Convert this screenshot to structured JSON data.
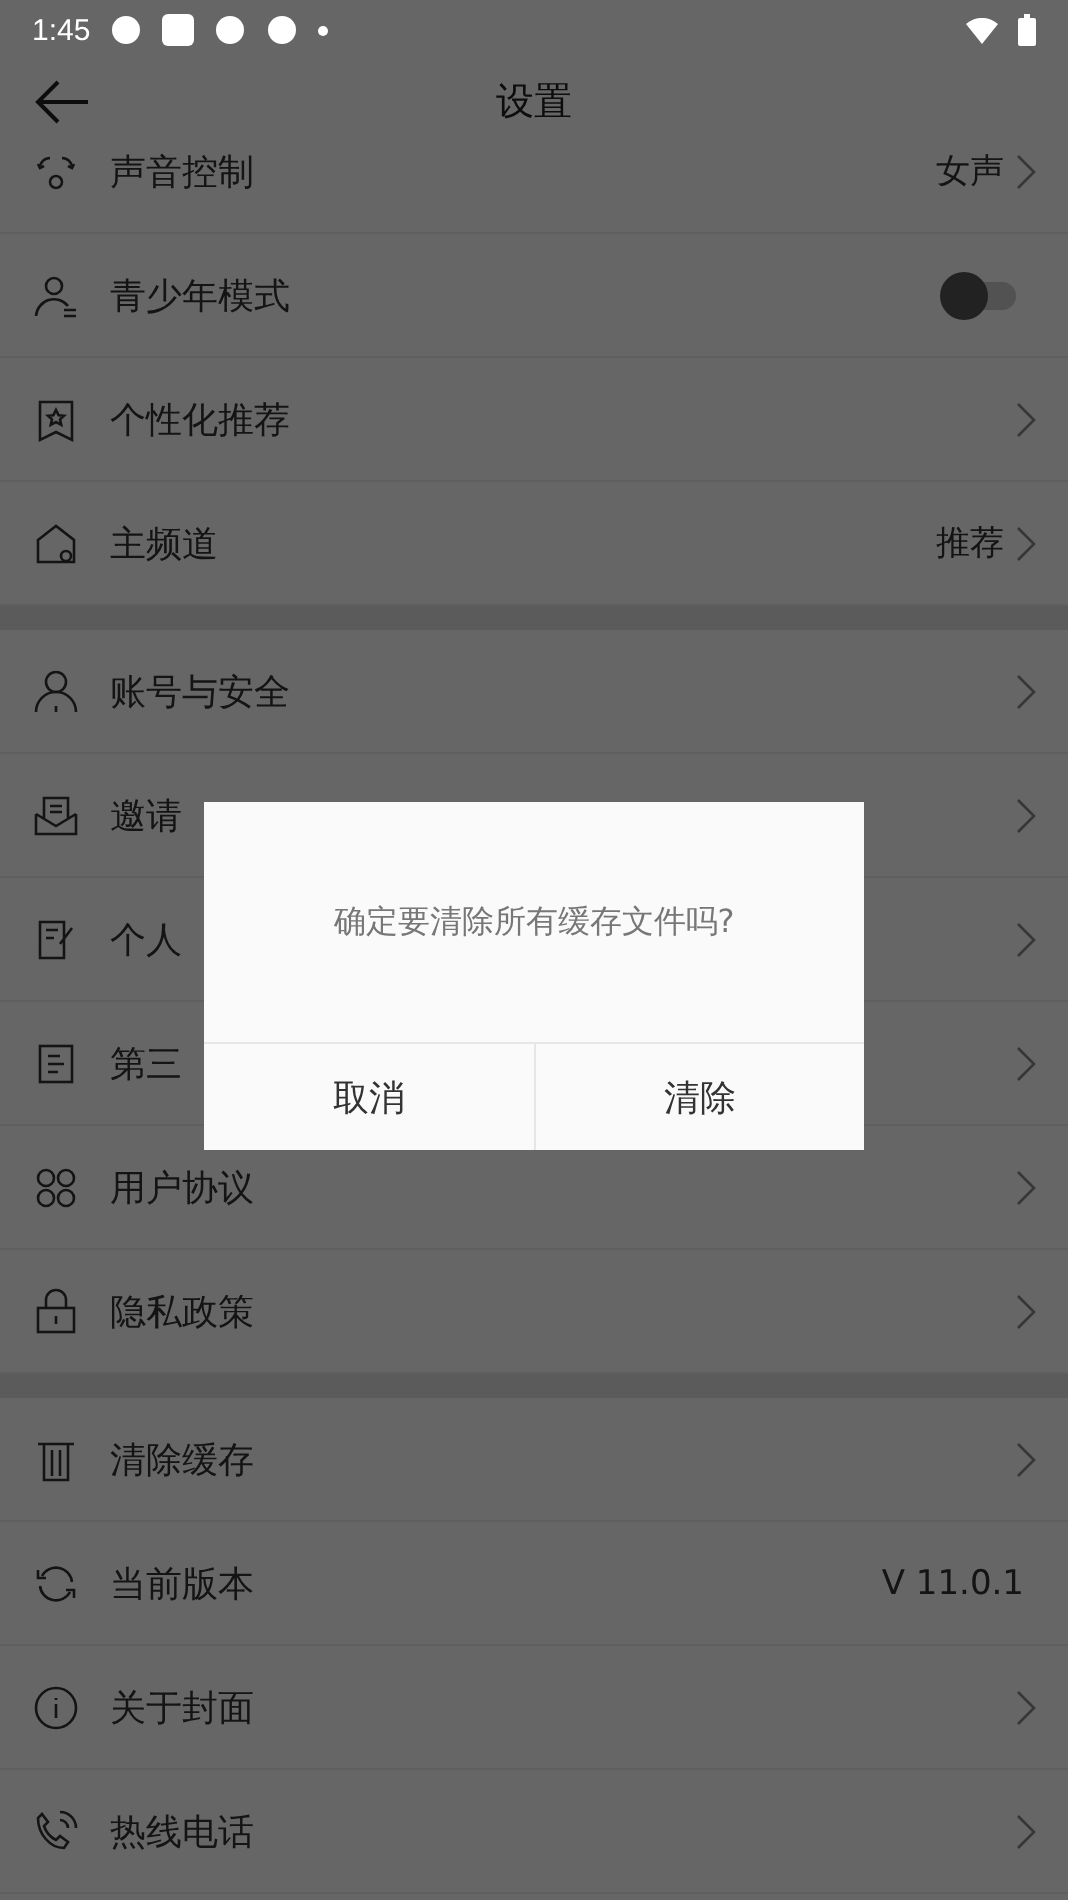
{
  "status_bar": {
    "time": "1:45"
  },
  "header": {
    "title": "设置"
  },
  "sections": [
    {
      "rows": [
        {
          "label": "声音控制",
          "kind": "chevron",
          "value": "女声"
        },
        {
          "label": "青少年模式",
          "kind": "switch",
          "on": false
        },
        {
          "label": "个性化推荐",
          "kind": "chevron"
        },
        {
          "label": "主频道",
          "kind": "chevron",
          "value": "推荐"
        }
      ]
    },
    {
      "rows": [
        {
          "label": "账号与安全",
          "kind": "chevron"
        },
        {
          "label": "邀请",
          "kind": "chevron"
        },
        {
          "label": "个人",
          "kind": "chevron"
        },
        {
          "label": "第三",
          "kind": "chevron"
        },
        {
          "label": "用户协议",
          "kind": "chevron"
        },
        {
          "label": "隐私政策",
          "kind": "chevron"
        }
      ]
    },
    {
      "rows": [
        {
          "label": "清除缓存",
          "kind": "chevron"
        },
        {
          "label": "当前版本",
          "kind": "plain",
          "value": "V 11.0.1"
        },
        {
          "label": "关于封面",
          "kind": "chevron"
        },
        {
          "label": "热线电话",
          "kind": "chevron"
        }
      ]
    }
  ],
  "dialog": {
    "message": "确定要清除所有缓存文件吗?",
    "buttons": [
      "取消",
      "清除"
    ]
  }
}
